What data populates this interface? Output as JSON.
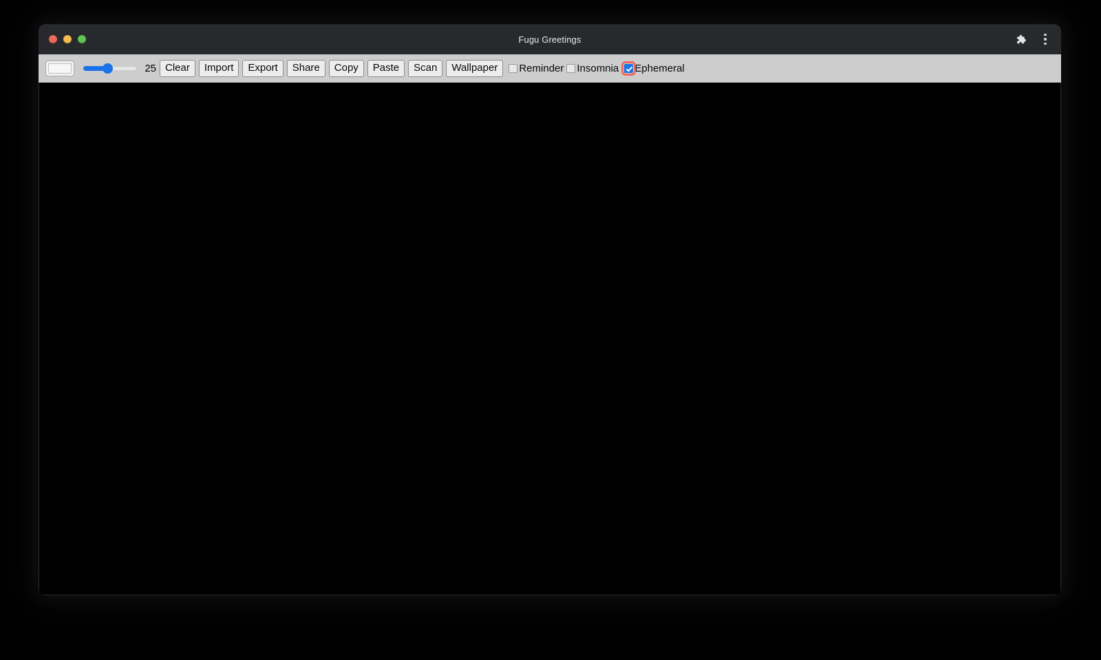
{
  "window": {
    "title": "Fugu Greetings",
    "traffic_lights": [
      {
        "name": "close",
        "color": "#ee6a5f"
      },
      {
        "name": "minimize",
        "color": "#f5bd4f"
      },
      {
        "name": "maximize",
        "color": "#61c454"
      }
    ],
    "titlebar_icons": [
      {
        "name": "extensions-puzzle-icon"
      },
      {
        "name": "browser-menu-kebab-icon"
      }
    ]
  },
  "toolbar": {
    "color_picker": {
      "label": "color-picker",
      "value": "#f7f7f7"
    },
    "slider": {
      "label": "line-width-slider",
      "value": "25",
      "min": "1",
      "max": "60",
      "percent": 43,
      "accent": "#1a73e8"
    },
    "buttons": [
      {
        "label": "Clear",
        "name": "clear-button"
      },
      {
        "label": "Import",
        "name": "import-button"
      },
      {
        "label": "Export",
        "name": "export-button"
      },
      {
        "label": "Share",
        "name": "share-button"
      },
      {
        "label": "Copy",
        "name": "copy-button"
      },
      {
        "label": "Paste",
        "name": "paste-button"
      },
      {
        "label": "Scan",
        "name": "scan-button"
      },
      {
        "label": "Wallpaper",
        "name": "wallpaper-button"
      }
    ],
    "checkboxes": [
      {
        "label": "Reminder",
        "name": "reminder-checkbox",
        "checked": false,
        "focused": false
      },
      {
        "label": "Insomnia",
        "name": "insomnia-checkbox",
        "checked": false,
        "focused": false
      },
      {
        "label": "Ephemeral",
        "name": "ephemeral-checkbox",
        "checked": true,
        "focused": true
      }
    ],
    "background": "#cdcdcd"
  },
  "canvas": {
    "name": "drawing-canvas",
    "background": "#000000"
  }
}
